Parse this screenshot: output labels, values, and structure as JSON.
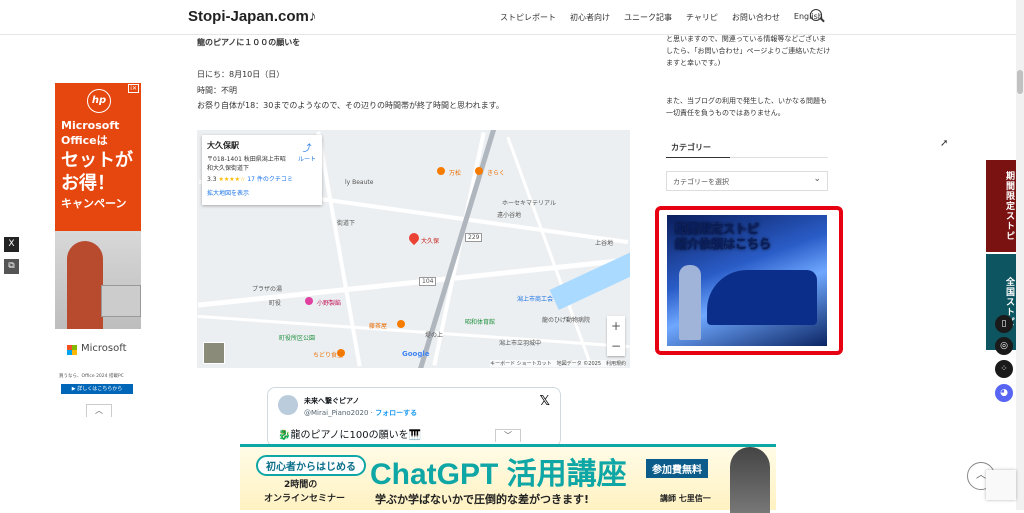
{
  "header": {
    "logo": "Stopi-Japan.com♪",
    "nav": [
      "ストピレポート",
      "初心者向け",
      "ユニーク記事",
      "チャリピ",
      "お問い合わせ",
      "English"
    ]
  },
  "article": {
    "heading": "龍のピアノに１００の願いを",
    "date": "日にち：8月10日（日）",
    "time": "時間：不明",
    "note": "お祭り自体が18：30までのようなので、その辺りの時間帯が終了時間と思われます。"
  },
  "map": {
    "place": "大久保駅",
    "address": "〒018-1401 秋田県潟上市昭和大久保街道下",
    "route": "ルート",
    "rating": "3.3",
    "stars": "★★★★☆",
    "reviews": "17 件のクチコミ",
    "enlarge": "拡大地図を表示",
    "labels": [
      "大久保",
      "万松",
      "きらく",
      "ホーセキマテリアル",
      "小野製餡",
      "藤茶屋",
      "プラザの湯",
      "潟上市商工会",
      "昭和体育館",
      "龍のひげ動物病院",
      "ちどり食堂",
      "町役所区公園",
      "潟上市立羽城中",
      "街道下",
      "上谷地",
      "ly Beaute",
      "104",
      "229",
      "遠小谷地",
      "町役",
      "堤の上"
    ],
    "zoom_in": "+",
    "zoom_out": "−",
    "google": "Google",
    "footer": "キーボード ショートカット　地図データ ©2025　利用規約"
  },
  "tweet": {
    "name": "未来へ繋ぐピアノ",
    "handle": "@Mirai_Piano2020 ·",
    "follow": "フォローする",
    "body": "🐉龍のピアノに100の願いを🎹"
  },
  "sidebar": {
    "contact_text": "と思いますので、関連っている情報等などございましたら、「お問い合わせ」ページよりご連絡いただけますと幸いです。)",
    "disclaimer": "また、当ブログの利用で発生した、いかなる問題も一切責任を負うものではありません。",
    "category_heading": "カテゴリー",
    "category_select": "カテゴリーを選択",
    "promo_line1": "期間限定ストピ",
    "promo_line2": "紹介依頼はこちら"
  },
  "left_ad": {
    "logo": "hp",
    "line1": "Microsoft",
    "line2": "Officeは",
    "line3": "セットが",
    "line4": "お得！",
    "line5": "キャンペーン",
    "brand": "Microsoft",
    "fine": "買うなら、Office 2024 搭載PC",
    "button": "▶ 詳しくはこちらから"
  },
  "share": {
    "x": "X",
    "copy": "⧉"
  },
  "right_tabs": {
    "tab1": "期間限定ストピ",
    "tab2": "全国ストピ"
  },
  "bottom_ad": {
    "pill": "初心者からはじめる",
    "two_hours": "2時間の",
    "online": "オンラインセミナー",
    "title": "ChatGPT 活用講座",
    "fee": "参加費無料",
    "subtitle": "学ぶか学ばないかで圧倒的な差がつきます!",
    "lecturer": "講師 七里信一"
  },
  "colors": {
    "accent_red": "#e60012",
    "teal": "#0fa6a6",
    "ad_orange": "#e6470f"
  }
}
